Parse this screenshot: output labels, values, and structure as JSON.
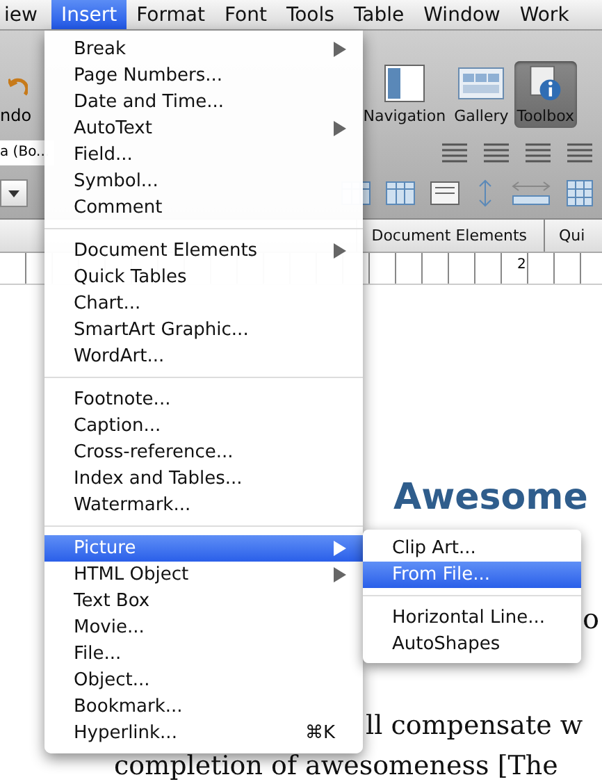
{
  "menu_bar": [
    {
      "label": "iew",
      "selected": false
    },
    {
      "label": "Insert",
      "selected": true
    },
    {
      "label": "Format",
      "selected": false
    },
    {
      "label": "Font",
      "selected": false
    },
    {
      "label": "Tools",
      "selected": false
    },
    {
      "label": "Table",
      "selected": false
    },
    {
      "label": "Window",
      "selected": false
    },
    {
      "label": "Work",
      "selected": false
    }
  ],
  "toolbar": {
    "undo_label": "ndo",
    "font_field": "a (Bo...",
    "buttons": [
      {
        "label": "Navigation",
        "kind": "navigation",
        "selected": false
      },
      {
        "label": "Gallery",
        "kind": "gallery",
        "selected": false
      },
      {
        "label": "Toolbox",
        "kind": "toolbox",
        "selected": true
      }
    ]
  },
  "ribbon_tabs": [
    {
      "label": "Document Elements",
      "selected": false
    },
    {
      "label": "Qui",
      "selected": false
    }
  ],
  "ruler": {
    "mark": "2"
  },
  "document": {
    "heading": "Awesome",
    "lines": [
      "o",
      "ll compensate w",
      "completion of awesomeness [The"
    ]
  },
  "insert_menu": [
    {
      "kind": "item",
      "label": "Break",
      "submenu": true,
      "selected": false
    },
    {
      "kind": "item",
      "label": "Page Numbers...",
      "submenu": false,
      "selected": false
    },
    {
      "kind": "item",
      "label": "Date and Time...",
      "submenu": false,
      "selected": false
    },
    {
      "kind": "item",
      "label": "AutoText",
      "submenu": true,
      "selected": false
    },
    {
      "kind": "item",
      "label": "Field...",
      "submenu": false,
      "selected": false
    },
    {
      "kind": "item",
      "label": "Symbol...",
      "submenu": false,
      "selected": false
    },
    {
      "kind": "item",
      "label": "Comment",
      "submenu": false,
      "selected": false
    },
    {
      "kind": "separator"
    },
    {
      "kind": "item",
      "label": "Document Elements",
      "submenu": true,
      "selected": false
    },
    {
      "kind": "item",
      "label": "Quick Tables",
      "submenu": false,
      "selected": false
    },
    {
      "kind": "item",
      "label": "Chart...",
      "submenu": false,
      "selected": false
    },
    {
      "kind": "item",
      "label": "SmartArt Graphic...",
      "submenu": false,
      "selected": false
    },
    {
      "kind": "item",
      "label": "WordArt...",
      "submenu": false,
      "selected": false
    },
    {
      "kind": "separator"
    },
    {
      "kind": "item",
      "label": "Footnote...",
      "submenu": false,
      "selected": false
    },
    {
      "kind": "item",
      "label": "Caption...",
      "submenu": false,
      "selected": false
    },
    {
      "kind": "item",
      "label": "Cross-reference...",
      "submenu": false,
      "selected": false
    },
    {
      "kind": "item",
      "label": "Index and Tables...",
      "submenu": false,
      "selected": false
    },
    {
      "kind": "item",
      "label": "Watermark...",
      "submenu": false,
      "selected": false
    },
    {
      "kind": "separator"
    },
    {
      "kind": "item",
      "label": "Picture",
      "submenu": true,
      "selected": true
    },
    {
      "kind": "item",
      "label": "HTML Object",
      "submenu": true,
      "selected": false
    },
    {
      "kind": "item",
      "label": "Text Box",
      "submenu": false,
      "selected": false
    },
    {
      "kind": "item",
      "label": "Movie...",
      "submenu": false,
      "selected": false
    },
    {
      "kind": "item",
      "label": "File...",
      "submenu": false,
      "selected": false
    },
    {
      "kind": "item",
      "label": "Object...",
      "submenu": false,
      "selected": false
    },
    {
      "kind": "item",
      "label": "Bookmark...",
      "submenu": false,
      "selected": false
    },
    {
      "kind": "item",
      "label": "Hyperlink...",
      "submenu": false,
      "selected": false,
      "shortcut": "⌘K"
    }
  ],
  "picture_submenu": [
    {
      "kind": "item",
      "label": "Clip Art...",
      "selected": false
    },
    {
      "kind": "item",
      "label": "From File...",
      "selected": true
    },
    {
      "kind": "separator"
    },
    {
      "kind": "item",
      "label": "Horizontal Line...",
      "selected": false
    },
    {
      "kind": "item",
      "label": "AutoShapes",
      "selected": false
    }
  ]
}
